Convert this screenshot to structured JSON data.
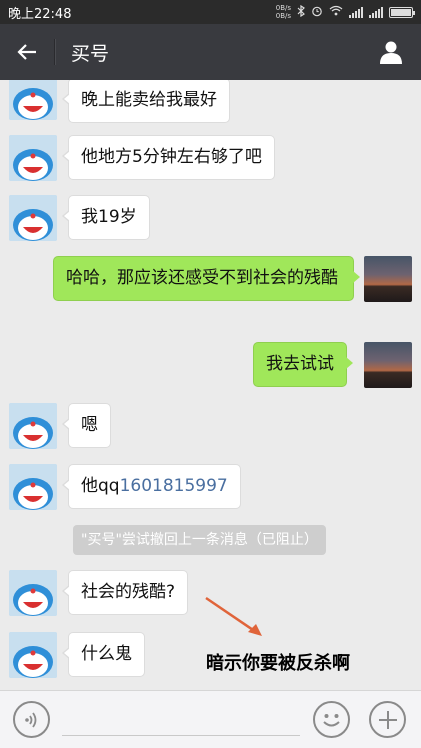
{
  "status_bar": {
    "time": "晚上22:48",
    "net_up": "0B/s",
    "net_down": "0B/s"
  },
  "header": {
    "title": "买号",
    "back_icon": "arrow-left",
    "profile_icon": "person"
  },
  "messages": [
    {
      "side": "left",
      "text": "晚上能卖给我最好"
    },
    {
      "side": "left",
      "text": "他地方5分钟左右够了吧"
    },
    {
      "side": "left",
      "text": "我19岁"
    },
    {
      "side": "right",
      "text": "哈哈，那应该还感受不到社会的残酷"
    },
    {
      "side": "right",
      "text": "我去试试"
    },
    {
      "side": "left",
      "text": "嗯"
    },
    {
      "side": "left",
      "text": "他qq",
      "link": "1601815997"
    },
    {
      "side": "left",
      "text": "社会的残酷?"
    },
    {
      "side": "left",
      "text": "什么鬼"
    }
  ],
  "system_notice": "\"买号\"尝试撤回上一条消息（已阻止）",
  "annotation": "暗示你要被反杀啊",
  "colors": {
    "header_bg": "#393a3f",
    "chat_bg": "#ebebeb",
    "sent_bubble": "#a0e75a",
    "received_bubble": "#ffffff",
    "annotation_arrow": "#e0643a"
  }
}
